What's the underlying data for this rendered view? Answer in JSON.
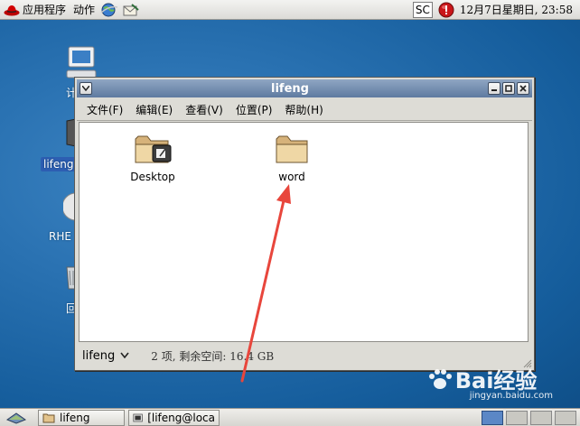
{
  "top_panel": {
    "applications_label": "应用程序",
    "actions_label": "动作",
    "sc_label": "SC",
    "clock": "12月7日星期日, 23:58"
  },
  "desktop": {
    "icons": [
      {
        "label": "计",
        "icon": "computer-icon"
      },
      {
        "label": "lifeng",
        "icon": "home-folder-icon"
      },
      {
        "label": "RHE",
        "icon": "cdrom-icon"
      },
      {
        "label": "回",
        "icon": "trash-icon"
      }
    ]
  },
  "window": {
    "title": "lifeng",
    "menu": [
      {
        "label": "文件(F)"
      },
      {
        "label": "编辑(E)"
      },
      {
        "label": "查看(V)"
      },
      {
        "label": "位置(P)"
      },
      {
        "label": "帮助(H)"
      }
    ],
    "files": [
      {
        "name": "Desktop",
        "icon": "desktop-folder-icon"
      },
      {
        "name": "word",
        "icon": "folder-icon"
      }
    ],
    "location_select": "lifeng",
    "status": "2 项, 剩余空间: 16.4 GB"
  },
  "taskbar": {
    "tasks": [
      {
        "label": "lifeng",
        "icon": "folder-icon"
      },
      {
        "label": "[lifeng@loca",
        "icon": "terminal-icon"
      }
    ]
  },
  "watermark": {
    "brand": "Bai经验",
    "url": "jingyan.baidu.com"
  },
  "colors": {
    "desktop_bg": "#2a72b2",
    "titlebar": "#6f89ad",
    "annotation_arrow": "#e8463c",
    "selection": "#2d5eb2"
  }
}
